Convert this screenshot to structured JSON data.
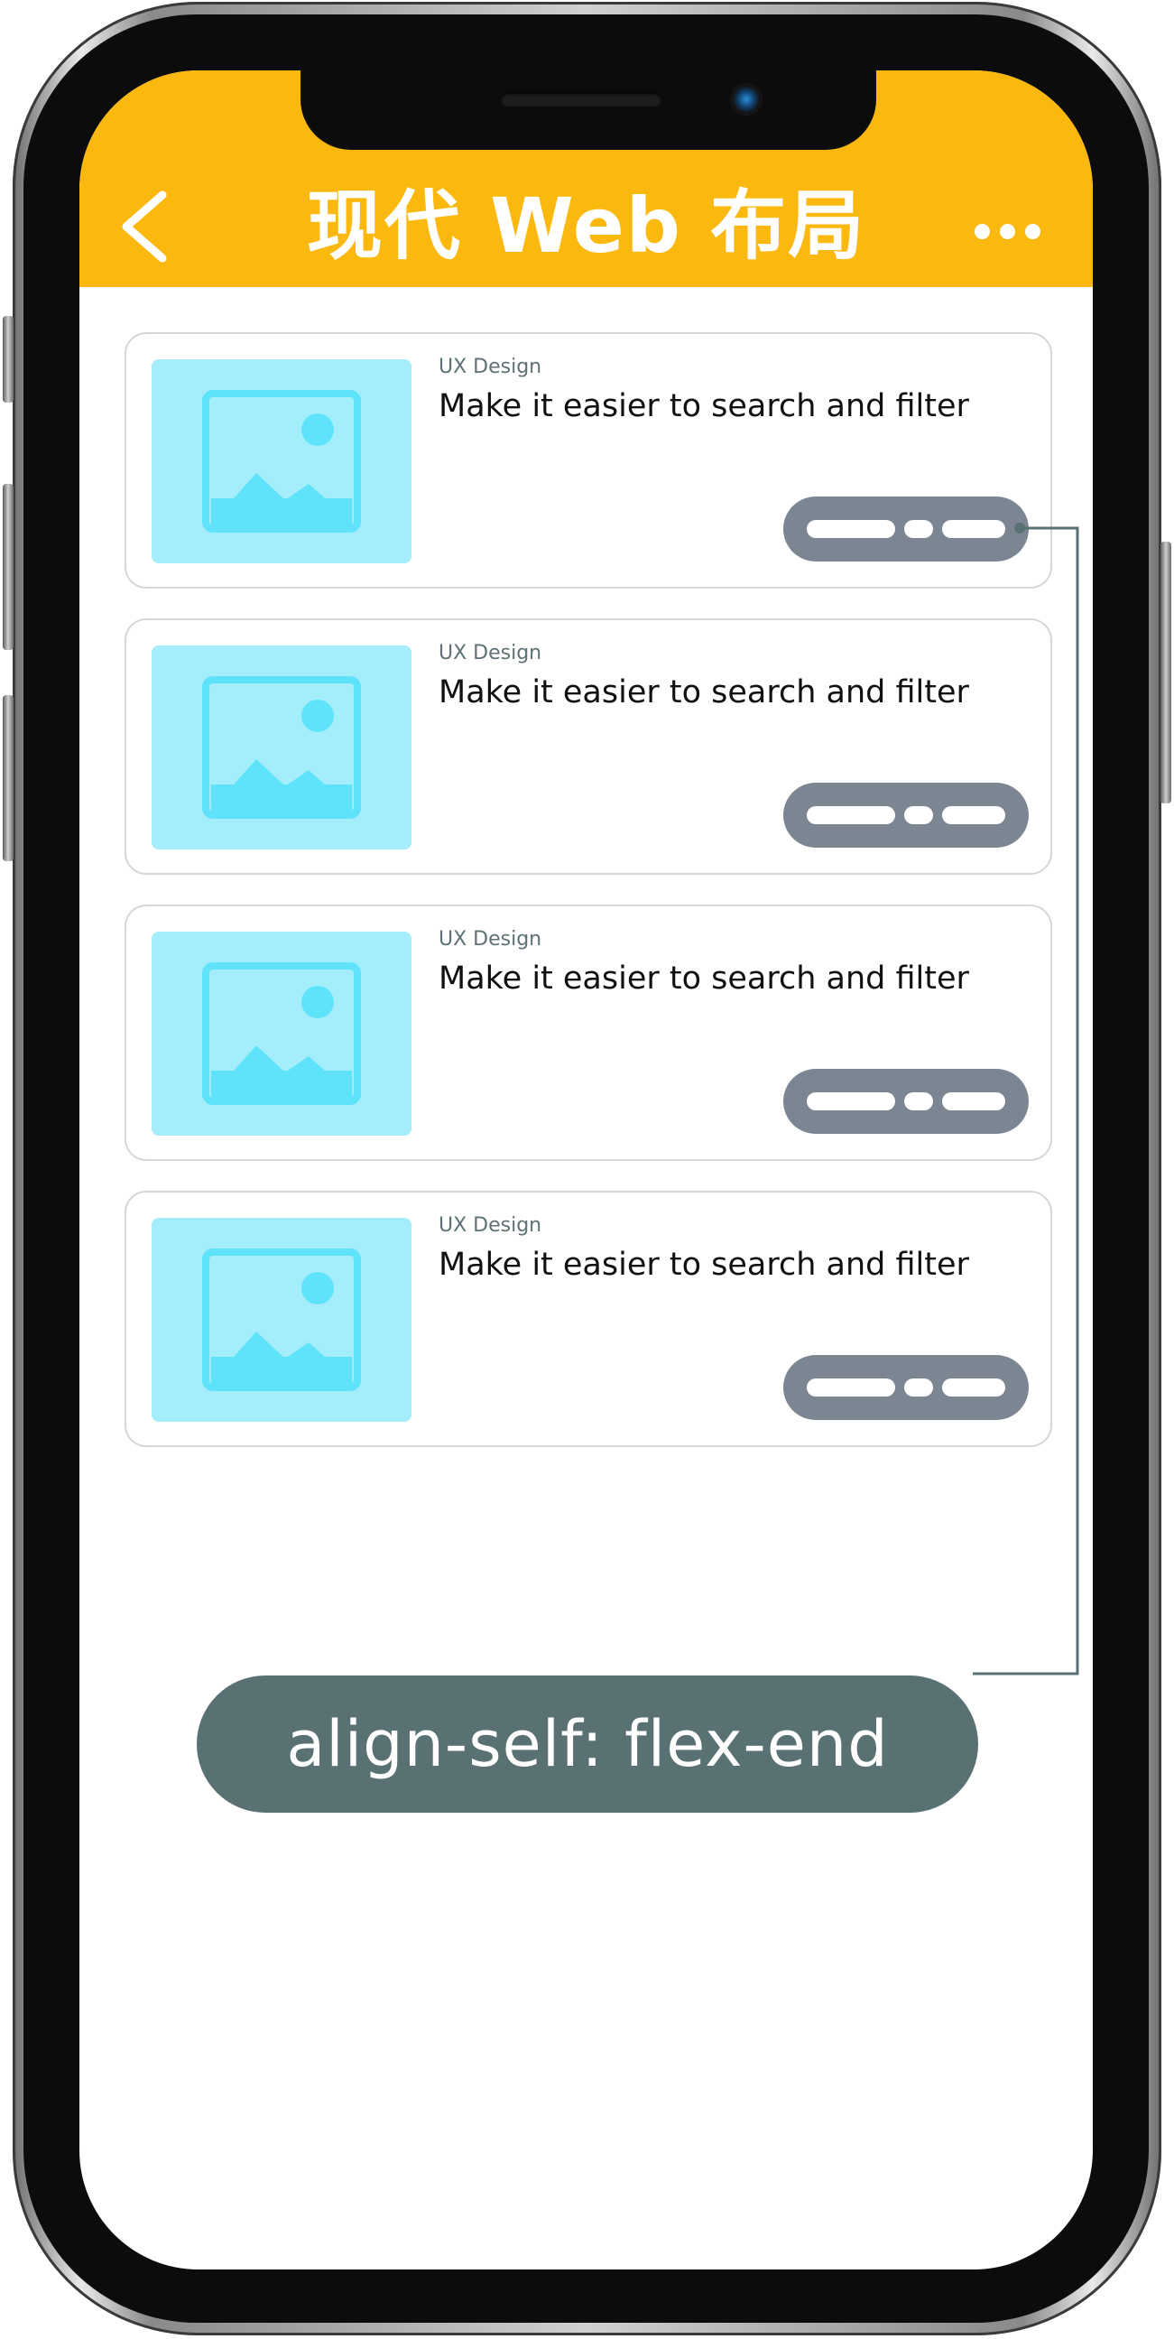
{
  "header": {
    "title": "现代 Web 布局",
    "background_color": "#fbb80f",
    "back_icon": "chevron-left-icon",
    "more_icon": "more-horizontal-icon"
  },
  "cards": [
    {
      "category": "UX Design",
      "title": "Make it easier to search and filter",
      "thumbnail_icon": "image-placeholder-icon"
    },
    {
      "category": "UX Design",
      "title": "Make it easier to search and filter",
      "thumbnail_icon": "image-placeholder-icon"
    },
    {
      "category": "UX Design",
      "title": "Make it easier to search and filter",
      "thumbnail_icon": "image-placeholder-icon"
    },
    {
      "category": "UX Design",
      "title": "Make it easier to search and filter",
      "thumbnail_icon": "image-placeholder-icon"
    }
  ],
  "annotation": {
    "label": "align-self: flex-end",
    "color": "#5a7173"
  },
  "colors": {
    "accent": "#fbb80f",
    "thumbnail_bg": "#a4edfb",
    "thumbnail_icon": "#5fe3fb",
    "pill": "#7b8692",
    "category_text": "#5e7275"
  }
}
